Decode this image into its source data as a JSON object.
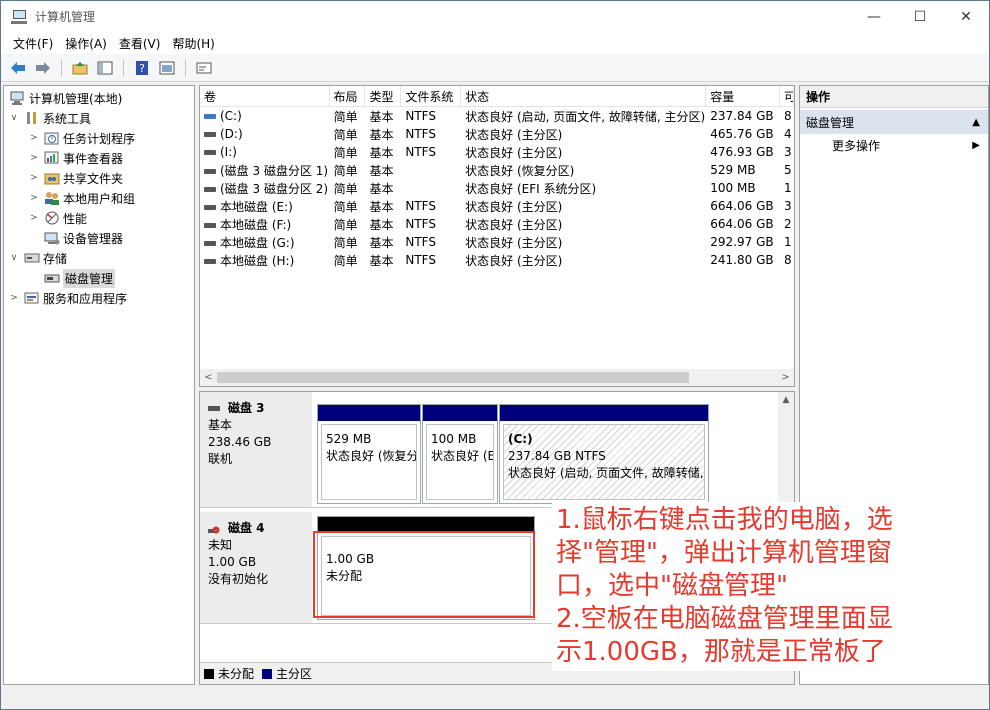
{
  "window": {
    "title": "计算机管理"
  },
  "window_controls": {
    "minimize": "—",
    "maximize": "☐",
    "close": "✕"
  },
  "menu": [
    "文件(F)",
    "操作(A)",
    "查看(V)",
    "帮助(H)"
  ],
  "tree": [
    {
      "label": "计算机管理(本地)",
      "level": 0,
      "arrow": "",
      "icon": "computer-icon"
    },
    {
      "label": "系统工具",
      "level": 1,
      "arrow": "∨",
      "icon": "tools-icon"
    },
    {
      "label": "任务计划程序",
      "level": 2,
      "arrow": ">",
      "icon": "clock-icon"
    },
    {
      "label": "事件查看器",
      "level": 2,
      "arrow": ">",
      "icon": "event-viewer-icon"
    },
    {
      "label": "共享文件夹",
      "level": 2,
      "arrow": ">",
      "icon": "shared-folder-icon"
    },
    {
      "label": "本地用户和组",
      "level": 2,
      "arrow": ">",
      "icon": "users-icon"
    },
    {
      "label": "性能",
      "level": 2,
      "arrow": ">",
      "icon": "performance-icon"
    },
    {
      "label": "设备管理器",
      "level": 2,
      "arrow": "",
      "icon": "device-manager-icon"
    },
    {
      "label": "存储",
      "level": 1,
      "arrow": "∨",
      "icon": "storage-icon"
    },
    {
      "label": "磁盘管理",
      "level": 2,
      "arrow": "",
      "icon": "disk-icon",
      "selected": true
    },
    {
      "label": "服务和应用程序",
      "level": 1,
      "arrow": ">",
      "icon": "services-icon"
    }
  ],
  "volume_list": {
    "headers": [
      "卷",
      "布局",
      "类型",
      "文件系统",
      "状态",
      "容量",
      "可"
    ],
    "rows": [
      {
        "vol": "(C:)",
        "layout": "简单",
        "type": "基本",
        "fs": "NTFS",
        "status": "状态良好 (启动, 页面文件, 故障转储, 主分区)",
        "capacity": "237.84 GB",
        "free": "8",
        "c": true
      },
      {
        "vol": "(D:)",
        "layout": "简单",
        "type": "基本",
        "fs": "NTFS",
        "status": "状态良好 (主分区)",
        "capacity": "465.76 GB",
        "free": "4"
      },
      {
        "vol": "(I:)",
        "layout": "简单",
        "type": "基本",
        "fs": "NTFS",
        "status": "状态良好 (主分区)",
        "capacity": "476.93 GB",
        "free": "3"
      },
      {
        "vol": "(磁盘 3 磁盘分区 1)",
        "layout": "简单",
        "type": "基本",
        "fs": "",
        "status": "状态良好 (恢复分区)",
        "capacity": "529 MB",
        "free": "5"
      },
      {
        "vol": "(磁盘 3 磁盘分区 2)",
        "layout": "简单",
        "type": "基本",
        "fs": "",
        "status": "状态良好 (EFI 系统分区)",
        "capacity": "100 MB",
        "free": "1"
      },
      {
        "vol": "本地磁盘 (E:)",
        "layout": "简单",
        "type": "基本",
        "fs": "NTFS",
        "status": "状态良好 (主分区)",
        "capacity": "664.06 GB",
        "free": "3"
      },
      {
        "vol": "本地磁盘 (F:)",
        "layout": "简单",
        "type": "基本",
        "fs": "NTFS",
        "status": "状态良好 (主分区)",
        "capacity": "664.06 GB",
        "free": "2"
      },
      {
        "vol": "本地磁盘 (G:)",
        "layout": "简单",
        "type": "基本",
        "fs": "NTFS",
        "status": "状态良好 (主分区)",
        "capacity": "292.97 GB",
        "free": "1"
      },
      {
        "vol": "本地磁盘 (H:)",
        "layout": "简单",
        "type": "基本",
        "fs": "NTFS",
        "status": "状态良好 (主分区)",
        "capacity": "241.80 GB",
        "free": "8"
      }
    ]
  },
  "disks": {
    "disk3": {
      "name": "磁盘 3",
      "kind": "基本",
      "size": "238.46 GB",
      "state": "联机",
      "partitions": [
        {
          "size": "529 MB",
          "status": "状态良好 (恢复分",
          "bar_color": "#00007f"
        },
        {
          "size": "100 MB",
          "status": "状态良好 (E",
          "bar_color": "#00007f"
        },
        {
          "label": "(C:)",
          "size": "237.84 GB NTFS",
          "status": "状态良好 (启动, 页面文件, 故障转储,",
          "bar_color": "#00007f"
        }
      ]
    },
    "disk4": {
      "name": "磁盘 4",
      "kind": "未知",
      "size": "1.00 GB",
      "state": "没有初始化",
      "partitions": [
        {
          "size": "1.00 GB",
          "status": "未分配",
          "bar_color": "#000000"
        }
      ]
    }
  },
  "legend": {
    "unallocated": "未分配",
    "primary": "主分区",
    "unallocated_color": "#000000",
    "primary_color": "#00007f"
  },
  "actions": {
    "header": "操作",
    "section": "磁盘管理",
    "more": "更多操作"
  },
  "annotation": {
    "line1": "1.鼠标右键点击我的电脑，选",
    "line2": "择\"管理\"，弹出计算机管理窗",
    "line3": "口，选中\"磁盘管理\"",
    "line4": "2.空板在电脑磁盘管理里面显",
    "line5": "示1.00GB，那就是正常板了"
  }
}
